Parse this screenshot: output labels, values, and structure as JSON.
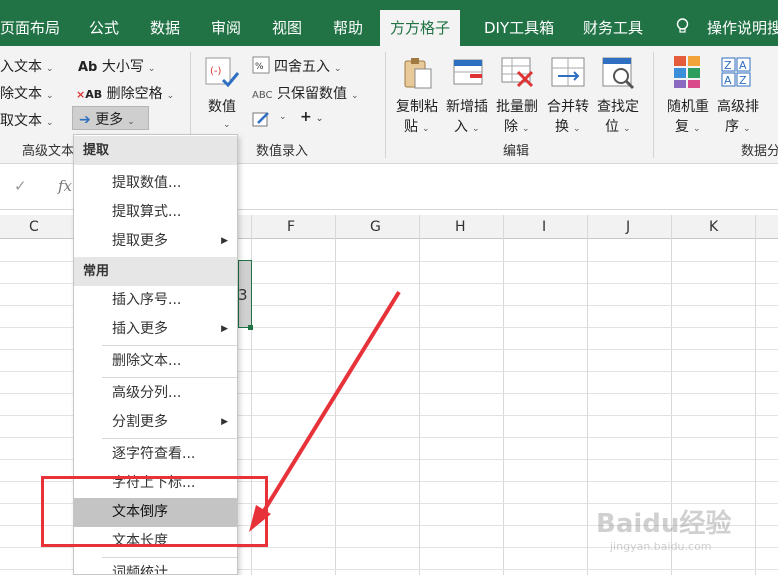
{
  "tabs": {
    "page_layout": "页面布局",
    "formulas": "公式",
    "data": "数据",
    "review": "审阅",
    "view": "视图",
    "help": "帮助",
    "fangfang": "方方格子",
    "diy": "DIY工具箱",
    "finance": "财务工具",
    "tell_me": "操作说明搜"
  },
  "ribbon": {
    "advanced_text": {
      "insert_text": "入文本",
      "delete_text": "除文本",
      "extract_text": "取文本",
      "case": "大小写",
      "remove_spaces": "删除空格",
      "more": "更多",
      "group_label": "高级文本"
    },
    "numeric_entry": {
      "round": "四舍五入",
      "keep_values": "只保留数值",
      "numeric_1": "数",
      "numeric_2": "值",
      "plus": "+",
      "group_label": "数值录入"
    },
    "edit": {
      "copy_paste_1": "复制粘",
      "copy_paste_2": "贴",
      "new_insert_1": "新增插",
      "new_insert_2": "入",
      "batch_delete_1": "批量删",
      "batch_delete_2": "除",
      "merge_convert_1": "合并转",
      "merge_convert_2": "换",
      "find_locate_1": "查找定",
      "find_locate_2": "位",
      "group_label": "编辑"
    },
    "data_analysis": {
      "random_1": "随机重",
      "random_2": "复",
      "sort_1": "高级排",
      "sort_2": "序",
      "group_label": "数据分"
    }
  },
  "formula_bar": {
    "check": "✓",
    "fx": "fx"
  },
  "columns": [
    "C",
    "F",
    "G",
    "H",
    "I",
    "J",
    "K"
  ],
  "selected_cell_value": "3",
  "menu": {
    "section_extract": "提取",
    "extract_value": "提取数值...",
    "extract_formula": "提取算式...",
    "extract_more": "提取更多",
    "section_common": "常用",
    "insert_seq": "插入序号...",
    "insert_more": "插入更多",
    "delete_text": "删除文本...",
    "advanced_split": "高级分列...",
    "split_more": "分割更多",
    "char_view": "逐字符查看...",
    "super_sub": "字符上下标...",
    "reverse_text": "文本倒序",
    "text_length": "文本长度",
    "word_stats": "词频统计..."
  },
  "watermark": {
    "brand": "Baidu经验",
    "url": "jingyan.baidu.com"
  },
  "colors": {
    "excel_green": "#217346",
    "annotation_red": "#e8323a"
  }
}
